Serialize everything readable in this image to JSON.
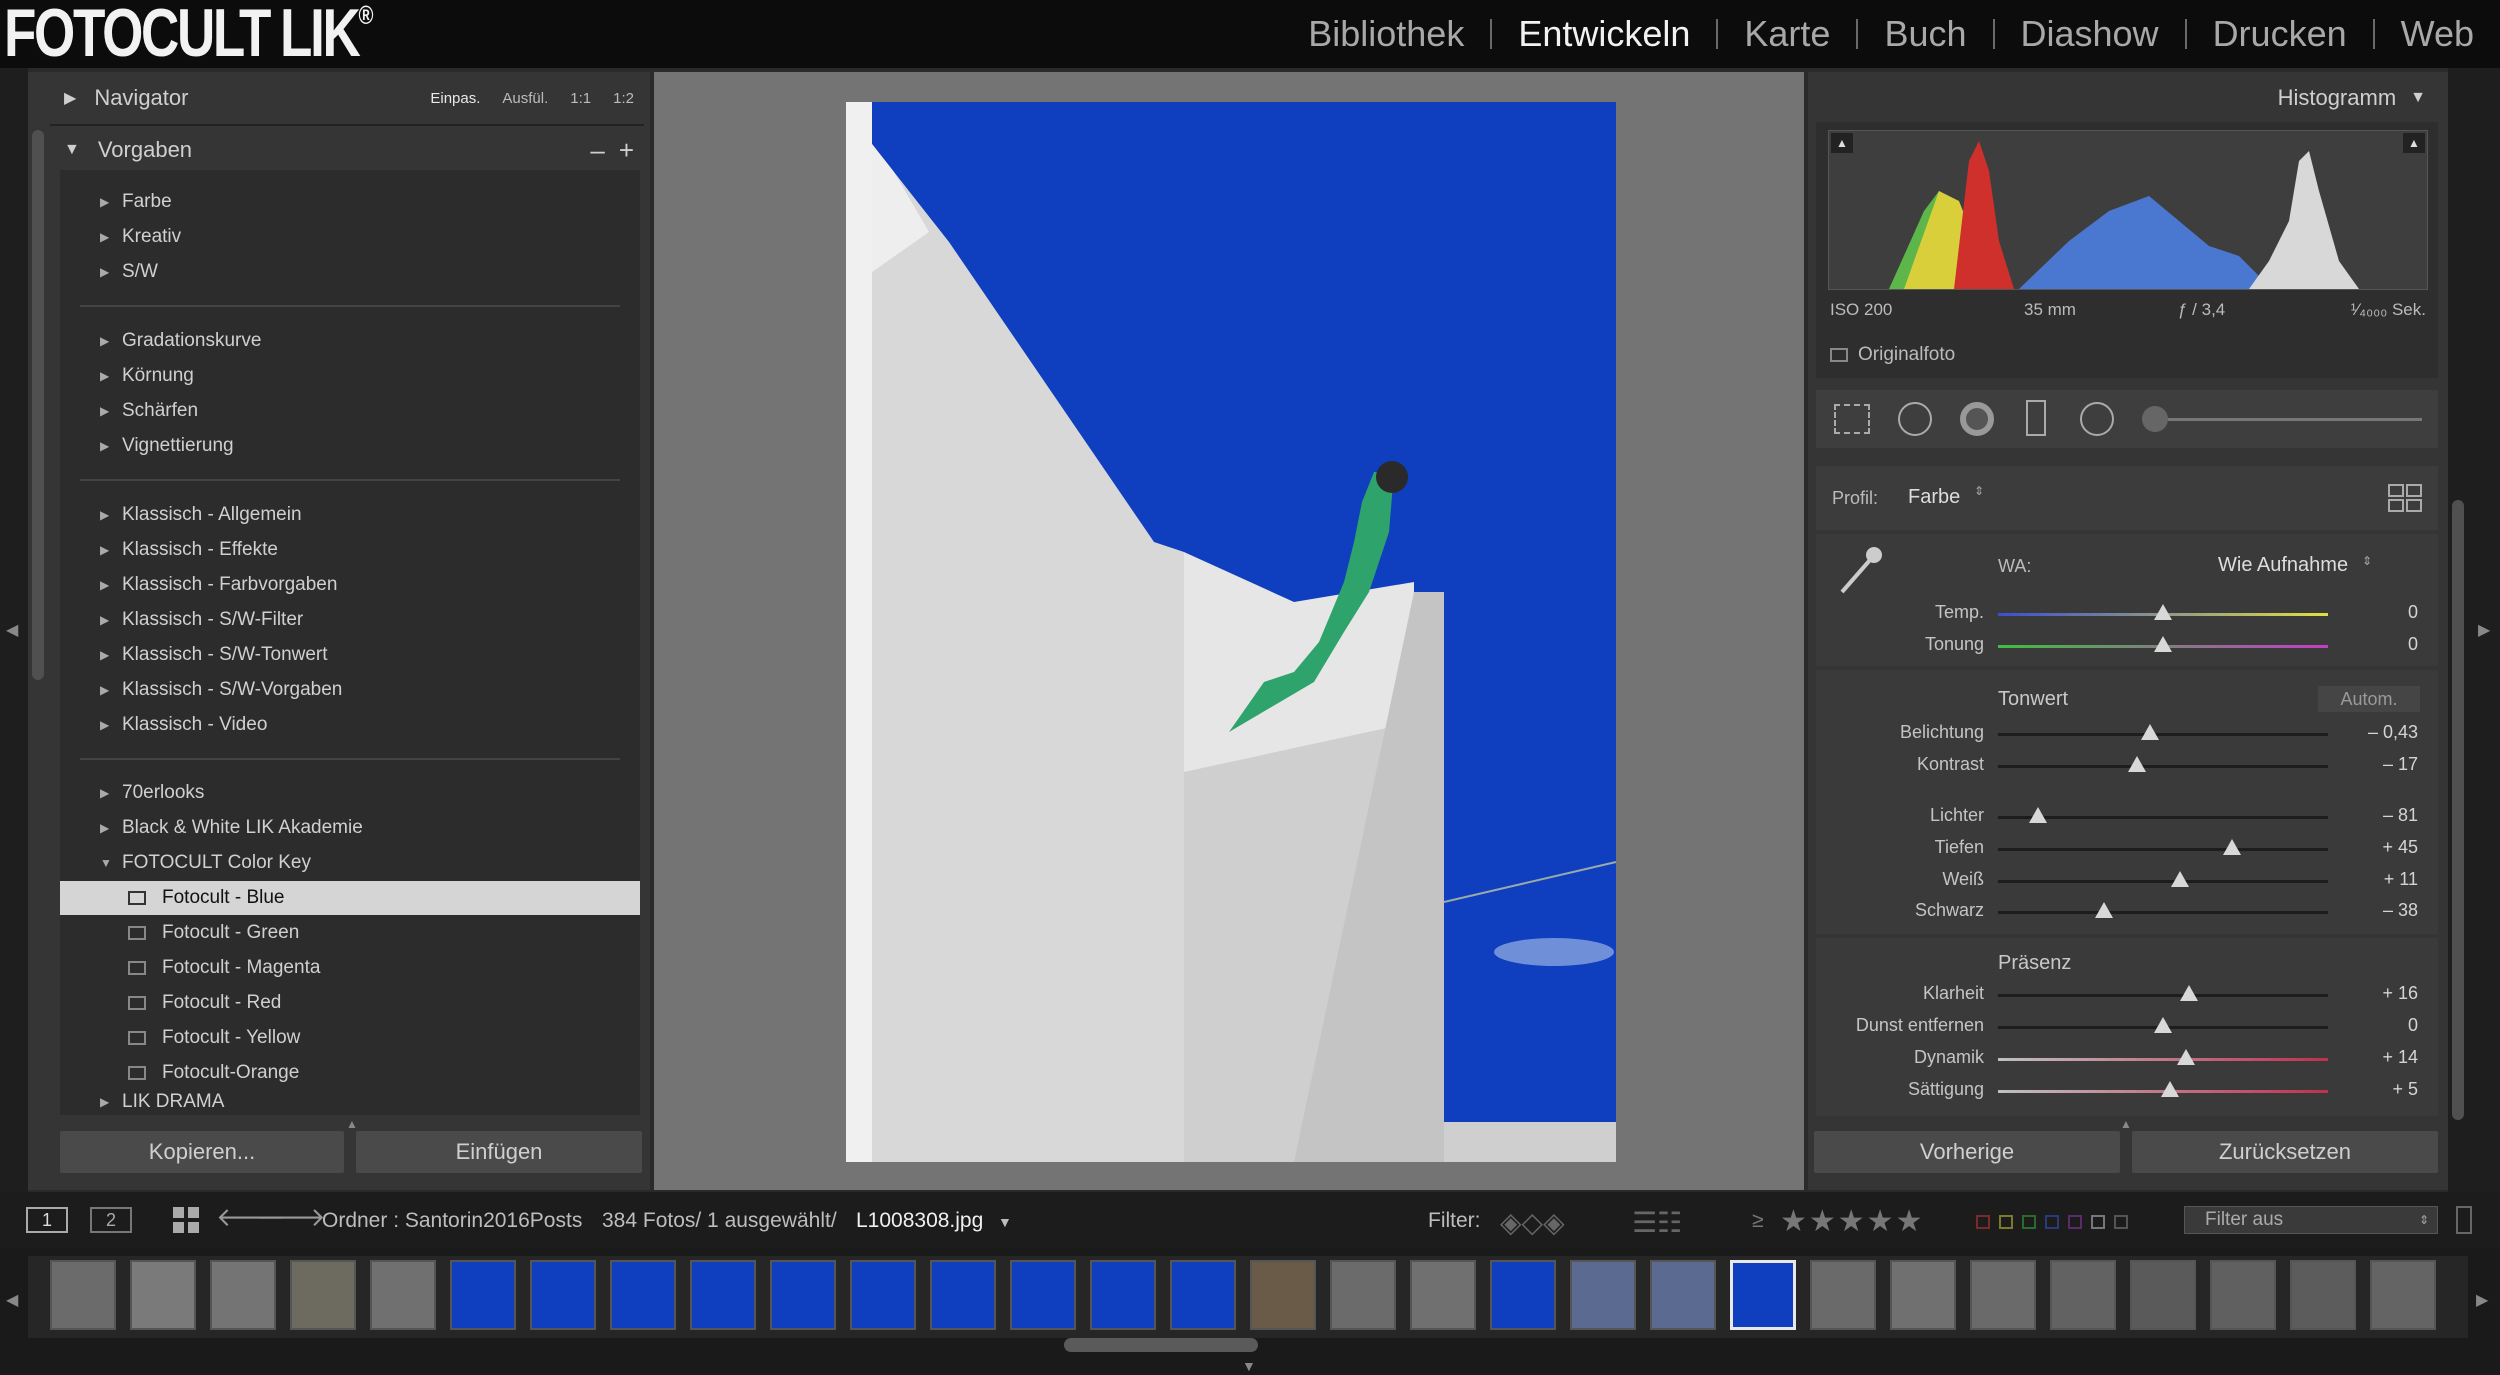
{
  "app": {
    "logo_text": "FOTOCULT LIK",
    "modules": [
      "Bibliothek",
      "Entwickeln",
      "Karte",
      "Buch",
      "Diashow",
      "Drucken",
      "Web"
    ],
    "active_module": "Entwickeln"
  },
  "navigator": {
    "title": "Navigator",
    "zoom_options": [
      "Einpas.",
      "Ausfül.",
      "1:1",
      "1:2"
    ]
  },
  "presets": {
    "title": "Vorgaben",
    "minus": "–",
    "plus": "+",
    "groups": [
      [
        "Farbe",
        "Kreativ",
        "S/W"
      ],
      [
        "Gradationskurve",
        "Körnung",
        "Schärfen",
        "Vignettierung"
      ],
      [
        "Klassisch - Allgemein",
        "Klassisch - Effekte",
        "Klassisch - Farbvorgaben",
        "Klassisch - S/W-Filter",
        "Klassisch - S/W-Tonwert",
        "Klassisch - S/W-Vorgaben",
        "Klassisch - Video"
      ]
    ],
    "user_folders": [
      "70erlooks",
      "Black & White LIK Akademie",
      "FOTOCULT Color Key"
    ],
    "open_folder_items": [
      "Fotocult - Blue",
      "Fotocult - Green",
      "Fotocult - Magenta",
      "Fotocult - Red",
      "Fotocult - Yellow",
      "Fotocult-Orange"
    ],
    "selected": "Fotocult - Blue",
    "after": "LIK DRAMA"
  },
  "left_buttons": {
    "copy": "Kopieren...",
    "paste": "Einfügen"
  },
  "histogram": {
    "title": "Histogramm",
    "iso": "ISO 200",
    "focal": "35 mm",
    "aperture": "ƒ / 3,4",
    "shutter": "¹⁄₄₀₀₀ Sek.",
    "original_label": "Originalfoto"
  },
  "basic": {
    "profile_label": "Profil:",
    "profile_value": "Farbe",
    "wb_label": "WA:",
    "wb_value": "Wie Aufnahme",
    "tone_header": "Tonwert",
    "auto_label": "Autom.",
    "presence_header": "Präsenz",
    "sliders": [
      {
        "label": "Temp.",
        "value": "0",
        "pos": 0.5
      },
      {
        "label": "Tonung",
        "value": "0",
        "pos": 0.5
      },
      {
        "label": "Belichtung",
        "value": "– 0,43",
        "pos": 0.46
      },
      {
        "label": "Kontrast",
        "value": "– 17",
        "pos": 0.42
      },
      {
        "label": "Lichter",
        "value": "– 81",
        "pos": 0.12
      },
      {
        "label": "Tiefen",
        "value": "+ 45",
        "pos": 0.71
      },
      {
        "label": "Weiß",
        "value": "+ 11",
        "pos": 0.55
      },
      {
        "label": "Schwarz",
        "value": "– 38",
        "pos": 0.32
      },
      {
        "label": "Klarheit",
        "value": "+ 16",
        "pos": 0.58
      },
      {
        "label": "Dunst entfernen",
        "value": "0",
        "pos": 0.5
      },
      {
        "label": "Dynamik",
        "value": "+ 14",
        "pos": 0.57
      },
      {
        "label": "Sättigung",
        "value": "+ 5",
        "pos": 0.52
      }
    ]
  },
  "right_buttons": {
    "previous": "Vorherige",
    "reset": "Zurücksetzen"
  },
  "filmbar": {
    "screen1": "1",
    "screen2": "2",
    "folder_label": "Ordner : Santorin2016Posts",
    "count": "384 Fotos/ 1 ausgewählt/",
    "filename": "L1008308.jpg",
    "filter_label": "Filter:",
    "rating_op": "≥",
    "filter_select": "Filter aus"
  },
  "colors": {
    "sky": "#0f3fbe",
    "dress": "#2ea36b",
    "hist_red": "#d0302b",
    "hist_yellow": "#d8cf3a",
    "hist_green": "#5db64a",
    "hist_blue": "#4a78d0"
  }
}
